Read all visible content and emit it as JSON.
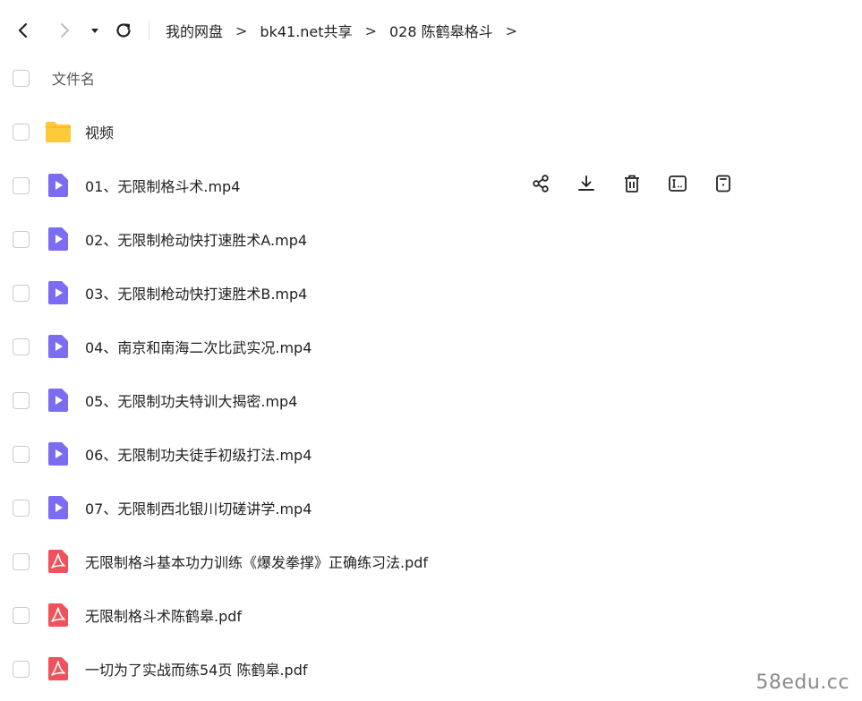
{
  "toolbar": {
    "back_icon": "chevron-left-icon",
    "forward_icon": "chevron-right-icon",
    "dropdown_icon": "caret-down-icon",
    "refresh_icon": "refresh-icon"
  },
  "breadcrumb": {
    "items": [
      "我的网盘",
      "bk41.net共享",
      "028 陈鹤皋格斗"
    ],
    "separator": ">"
  },
  "list": {
    "header_label": "文件名",
    "files": [
      {
        "name": "视频",
        "type": "folder"
      },
      {
        "name": "01、无限制格斗术.mp4",
        "type": "video"
      },
      {
        "name": "02、无限制枪动快打速胜术A.mp4",
        "type": "video"
      },
      {
        "name": "03、无限制枪动快打速胜术B.mp4",
        "type": "video"
      },
      {
        "name": "04、南京和南海二次比武实况.mp4",
        "type": "video"
      },
      {
        "name": "05、无限制功夫特训大揭密.mp4",
        "type": "video"
      },
      {
        "name": "06、无限制功夫徒手初级打法.mp4",
        "type": "video"
      },
      {
        "name": "07、无限制西北银川切磋讲学.mp4",
        "type": "video"
      },
      {
        "name": "无限制格斗基本功力训练《爆发拳撑》正确练习法.pdf",
        "type": "pdf"
      },
      {
        "name": "无限制格斗术陈鹤皋.pdf",
        "type": "pdf"
      },
      {
        "name": "一切为了实战而练54页 陈鹤皋.pdf",
        "type": "pdf"
      }
    ]
  },
  "row_actions": [
    "share-icon",
    "download-icon",
    "delete-icon",
    "rename-icon",
    "more-info-icon"
  ],
  "watermark": "58edu.cc",
  "colors": {
    "folder": "#FFC93C",
    "video": "#7B6CF2",
    "pdf": "#F0525B",
    "text": "#222222"
  }
}
